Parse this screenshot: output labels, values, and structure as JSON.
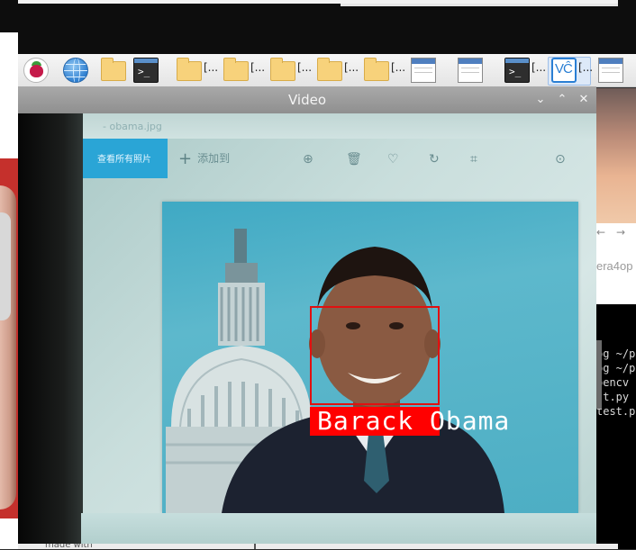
{
  "taskbar": {
    "items": [
      {
        "name": "raspberry-menu",
        "label": ""
      },
      {
        "name": "browser",
        "label": ""
      },
      {
        "name": "file-manager",
        "label": ""
      },
      {
        "name": "terminal",
        "label": ""
      },
      {
        "name": "folder-1",
        "label": "[..."
      },
      {
        "name": "folder-2",
        "label": "[..."
      },
      {
        "name": "folder-3",
        "label": "[..."
      },
      {
        "name": "folder-4",
        "label": "[..."
      },
      {
        "name": "folder-5",
        "label": "[..."
      },
      {
        "name": "window-1",
        "label": ""
      },
      {
        "name": "window-2",
        "label": ""
      },
      {
        "name": "terminal-2",
        "label": "[..."
      },
      {
        "name": "vnc",
        "label": "[..."
      },
      {
        "name": "window-3",
        "label": ""
      }
    ]
  },
  "video_window": {
    "title": "Video",
    "controls": {
      "minimize": "⌄",
      "maximize": "⌃",
      "close": "✕"
    }
  },
  "camera_frame": {
    "filename": "- obama.jpg",
    "view_all_label": "查看所有照片",
    "add_label": "添加到",
    "detection": {
      "label": "Barack Obama",
      "box_color": "#ff0000"
    }
  },
  "background": {
    "browser_partial_url": "era4op",
    "terminal_lines": [
      "pg ~/p",
      "pg ~/p",
      "pencv",
      "st.py",
      "test.p"
    ],
    "bottom_text": "made with"
  }
}
